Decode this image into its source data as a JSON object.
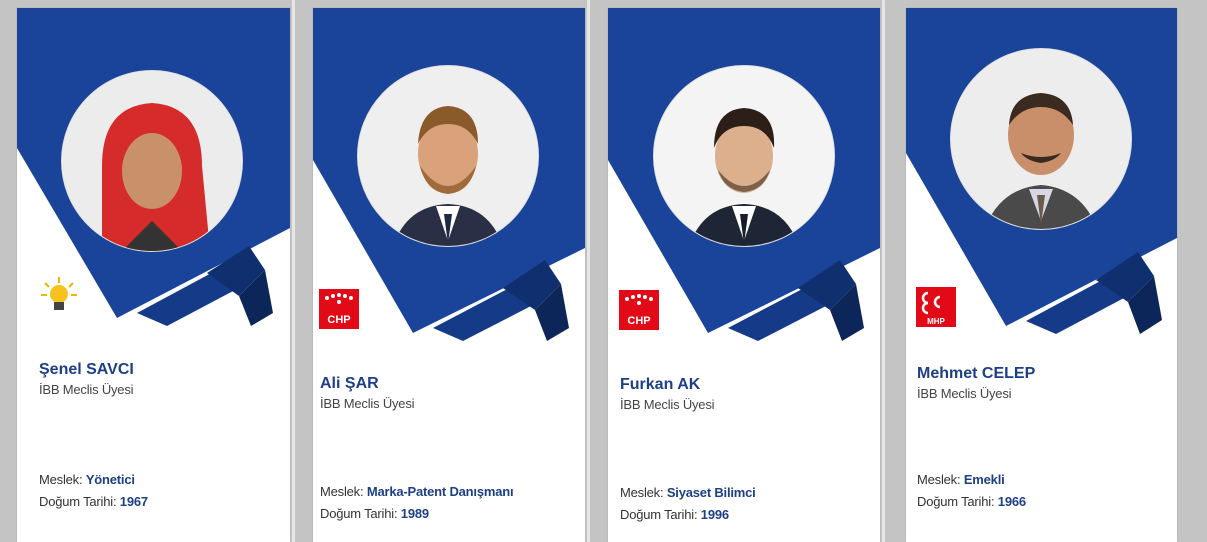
{
  "colors": {
    "primary": "#1a4499",
    "dark": "#102f6e",
    "name_text": "#1d3f86",
    "background": "#c4c4c4"
  },
  "labels": {
    "occupation": "Meslek:",
    "birth": "Doğum Tarihi:"
  },
  "members": [
    {
      "name": "Şenel SAVCI",
      "role": "İBB Meclis Üyesi",
      "occupation": "Yönetici",
      "birth_year": "1967",
      "party_icon": "ak-party-bulb-icon"
    },
    {
      "name": "Ali ŞAR",
      "role": "İBB Meclis Üyesi",
      "occupation": "Marka-Patent Danışmanı",
      "birth_year": "1989",
      "party_icon": "chp-logo-icon",
      "party_text": "CHP"
    },
    {
      "name": "Furkan AK",
      "role": "İBB Meclis Üyesi",
      "occupation": "Siyaset Bilimci",
      "birth_year": "1996",
      "party_icon": "chp-logo-icon",
      "party_text": "CHP"
    },
    {
      "name": "Mehmet CELEP",
      "role": "İBB Meclis Üyesi",
      "occupation": "Emekli",
      "birth_year": "1966",
      "party_icon": "mhp-logo-icon",
      "party_text": "MHP"
    }
  ]
}
